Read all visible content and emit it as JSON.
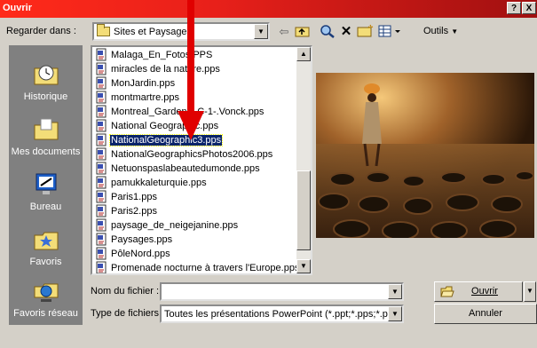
{
  "window": {
    "title": "Ouvrir",
    "help_label": "?",
    "close_label": "X"
  },
  "toolbar": {
    "look_in_label": "Regarder dans :",
    "look_in_value": "Sites et Paysages",
    "tools_label": "Outils",
    "icons": [
      "back-icon",
      "up-folder-icon",
      "search-web-icon",
      "delete-icon",
      "new-folder-icon",
      "views-icon"
    ]
  },
  "places": [
    {
      "label": "Historique",
      "icon": "history-icon"
    },
    {
      "label": "Mes documents",
      "icon": "my-documents-icon"
    },
    {
      "label": "Bureau",
      "icon": "desktop-icon"
    },
    {
      "label": "Favoris",
      "icon": "favorites-icon"
    },
    {
      "label": "Favoris réseau",
      "icon": "network-favorites-icon"
    }
  ],
  "files": [
    "Malaga_En_Fotos.PPS",
    "miracles de la nature.pps",
    "MonJardin.pps",
    "montmartre.pps",
    "Montreal_Gardens_C-1-.Vonck.pps",
    "National Geographic.pps",
    "NationalGeographic3.pps",
    "NationalGeographicsPhotos2006.pps",
    "Netuonspaslabeautedumonde.pps",
    "pamukkaleturquie.pps",
    "Paris1.pps",
    "Paris2.pps",
    "paysage_de_neigejanine.pps",
    "Paysages.pps",
    "PôleNord.pps",
    "Promenade nocturne à travers l'Europe.pps"
  ],
  "selected_file": "NationalGeographic3.pps",
  "form": {
    "filename_label": "Nom du fichier :",
    "filename_value": "",
    "filetype_label": "Type de fichiers :",
    "filetype_value": "Toutes les présentations PowerPoint (*.ppt;*.pps;*.pot"
  },
  "buttons": {
    "open": "Ouvrir",
    "cancel": "Annuler"
  },
  "colors": {
    "title_bar": "#e8201a",
    "selection": "#0a246a",
    "annotation_arrow": "#e00000"
  }
}
